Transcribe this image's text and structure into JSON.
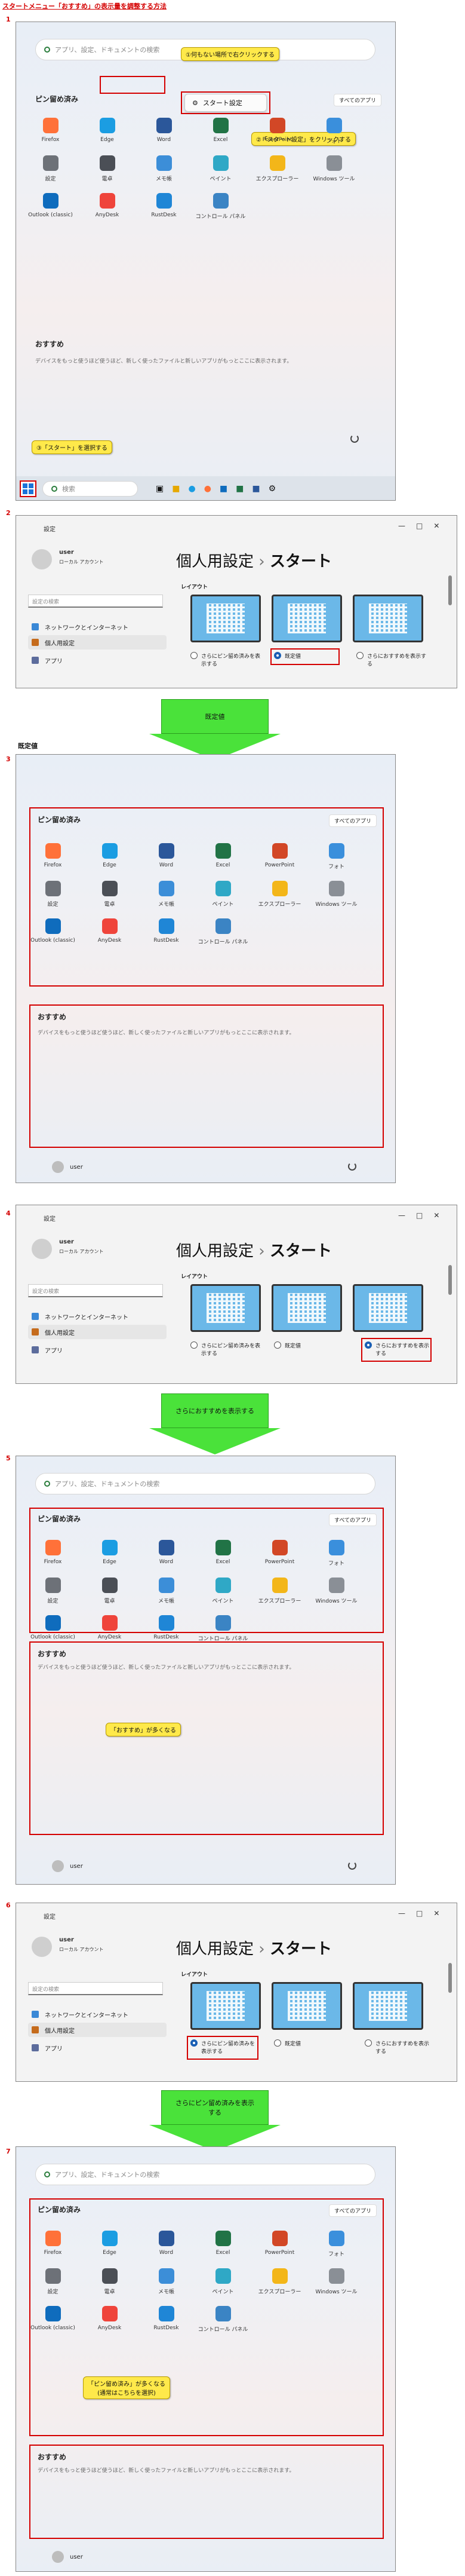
{
  "page_title": "スタートメニュー「おすすめ」の表示量を調整する方法",
  "section2_label": "既定値",
  "steps": [
    "1",
    "2",
    "3",
    "4",
    "5",
    "6",
    "7"
  ],
  "search_placeholder": "アプリ、設定、ドキュメントの検索",
  "pinned_label": "ピン留め済み",
  "all_apps_label": "すべてのアプリ",
  "rec_label": "おすすめ",
  "rec_text": "デバイスをもっと使うほど使うほど、新しく使ったファイルと新しいアプリがもっとここに表示されます。",
  "user_name": "user",
  "apps": [
    {
      "name": "Firefox",
      "icon": "firefox-icon",
      "color": "#ff7139"
    },
    {
      "name": "Edge",
      "icon": "edge-icon",
      "color": "#1b9de2"
    },
    {
      "name": "Word",
      "icon": "word-icon",
      "color": "#2b579a"
    },
    {
      "name": "Excel",
      "icon": "excel-icon",
      "color": "#217346"
    },
    {
      "name": "PowerPoint",
      "icon": "powerpoint-icon",
      "color": "#d24726"
    },
    {
      "name": "フォト",
      "icon": "photos-icon",
      "color": "#3a8fdc"
    },
    {
      "name": "設定",
      "icon": "settings-gear-icon",
      "color": "#6d7178"
    },
    {
      "name": "電卓",
      "icon": "calculator-icon",
      "color": "#4b4f56"
    },
    {
      "name": "メモ帳",
      "icon": "notepad-icon",
      "color": "#3c8ed8"
    },
    {
      "name": "ペイント",
      "icon": "paint-icon",
      "color": "#2fa8c6"
    },
    {
      "name": "エクスプローラー",
      "icon": "folder-icon",
      "color": "#f3b619"
    },
    {
      "name": "Windows ツール",
      "icon": "windows-tools-icon",
      "color": "#8a8f96"
    },
    {
      "name": "Outlook (classic)",
      "icon": "outlook-icon",
      "color": "#0f6cbd"
    },
    {
      "name": "AnyDesk",
      "icon": "anydesk-icon",
      "color": "#ef443b"
    },
    {
      "name": "RustDesk",
      "icon": "rustdesk-icon",
      "color": "#1f86d6"
    },
    {
      "name": "コントロール パネル",
      "icon": "control-panel-icon",
      "color": "#3b84c4"
    }
  ],
  "notes": {
    "n1": "①何もない場所で右クリックする",
    "n2": "②「スタート設定」をクリックする",
    "n3": "③「スタート」を選択する",
    "n5": "「おすすめ」が多くなる",
    "n7a": "「ピン留め済み」が多くなる",
    "n7b": "(通常はこちらを選択)"
  },
  "ctx_menu_label": "スタート設定",
  "taskbar_search": "検索",
  "settings": {
    "title": "設定",
    "account": "ローカル アカウント",
    "search_placeholder": "設定の検索",
    "nav": [
      "ネットワークとインターネット",
      "個人用設定",
      "アプリ"
    ],
    "breadcrumb_parent": "個人用設定",
    "breadcrumb_sep": "›",
    "breadcrumb_current": "スタート",
    "layout_label": "レイアウト",
    "opt_more_pins": "さらにピン留め済みを表示する",
    "opt_default": "既定値",
    "opt_more_recs": "さらにおすすめを表示する"
  },
  "arrows": {
    "a1": "既定値",
    "a2": "さらにおすすめを表示する",
    "a3": "さらにピン留め済みを表示する"
  },
  "colors": {
    "highlight_red": "#d40000",
    "note_yellow": "#ffe94a",
    "arrow_green": "#4ae23a",
    "radio_blue": "#1a5fb4"
  }
}
